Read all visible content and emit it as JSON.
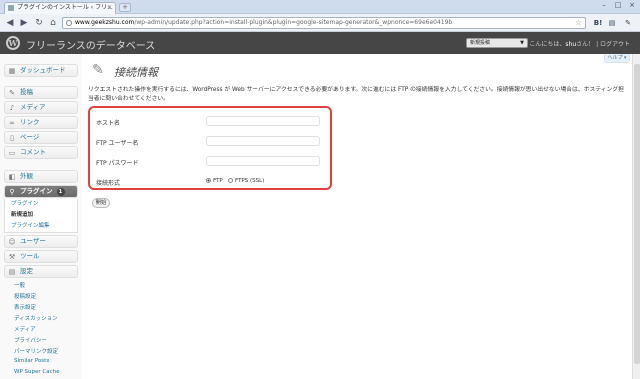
{
  "browser": {
    "tab_title": "プラグインのインストール ‹ フリ...",
    "tab_close": "×",
    "new_tab": "+",
    "url_domain": "www.geekzshu.com",
    "url_rest": "/wp-admin/update.php?action=install-plugin&plugin=google-sitemap-generator&_wpnonce=69e6e0419b",
    "ext_b": "B!",
    "window_buttons": [
      "–",
      "□",
      "×"
    ]
  },
  "header": {
    "site_name": "フリーランスのデータベース",
    "new_post_select": "新規投稿",
    "greeting_prefix": "こんにちは、",
    "user": "shu",
    "greeting_suffix": "さん！ | ログアウト",
    "help_tab": "ヘルプ ▾"
  },
  "sidebar": {
    "dashboard": "ダッシュボード",
    "posts": "投稿",
    "media": "メディア",
    "links": "リンク",
    "pages": "ページ",
    "comments": "コメント",
    "appearance": "外観",
    "plugins": "プラグイン",
    "plugins_badge": "1",
    "plugins_sub": [
      "プラグイン",
      "新規追加",
      "プラグイン編集"
    ],
    "users": "ユーザー",
    "tools": "ツール",
    "settings": "設定",
    "settings_sub": [
      "一般",
      "投稿設定",
      "表示設定",
      "ディスカッション",
      "メディア",
      "プライバシー",
      "パーマリンク設定",
      "Similar Posts",
      "WP Super Cache"
    ]
  },
  "main": {
    "title": "接続情報",
    "intro": "リクエストされた操作を実行するには、WordPress が Web サーバーにアクセスできる必要があります。次に進むには FTP の接続情報を入力してください。接続情報が思い出せない場合は、ホスティング担当者に問い合わせてください。",
    "hostname_label": "ホスト名",
    "ftp_user_label": "FTP ユーザー名",
    "ftp_pass_label": "FTP パスワード",
    "conn_type_label": "接続形式",
    "conn_ftp": "FTP",
    "conn_ftps": "FTPS (SSL)",
    "proceed_button": "開始"
  }
}
